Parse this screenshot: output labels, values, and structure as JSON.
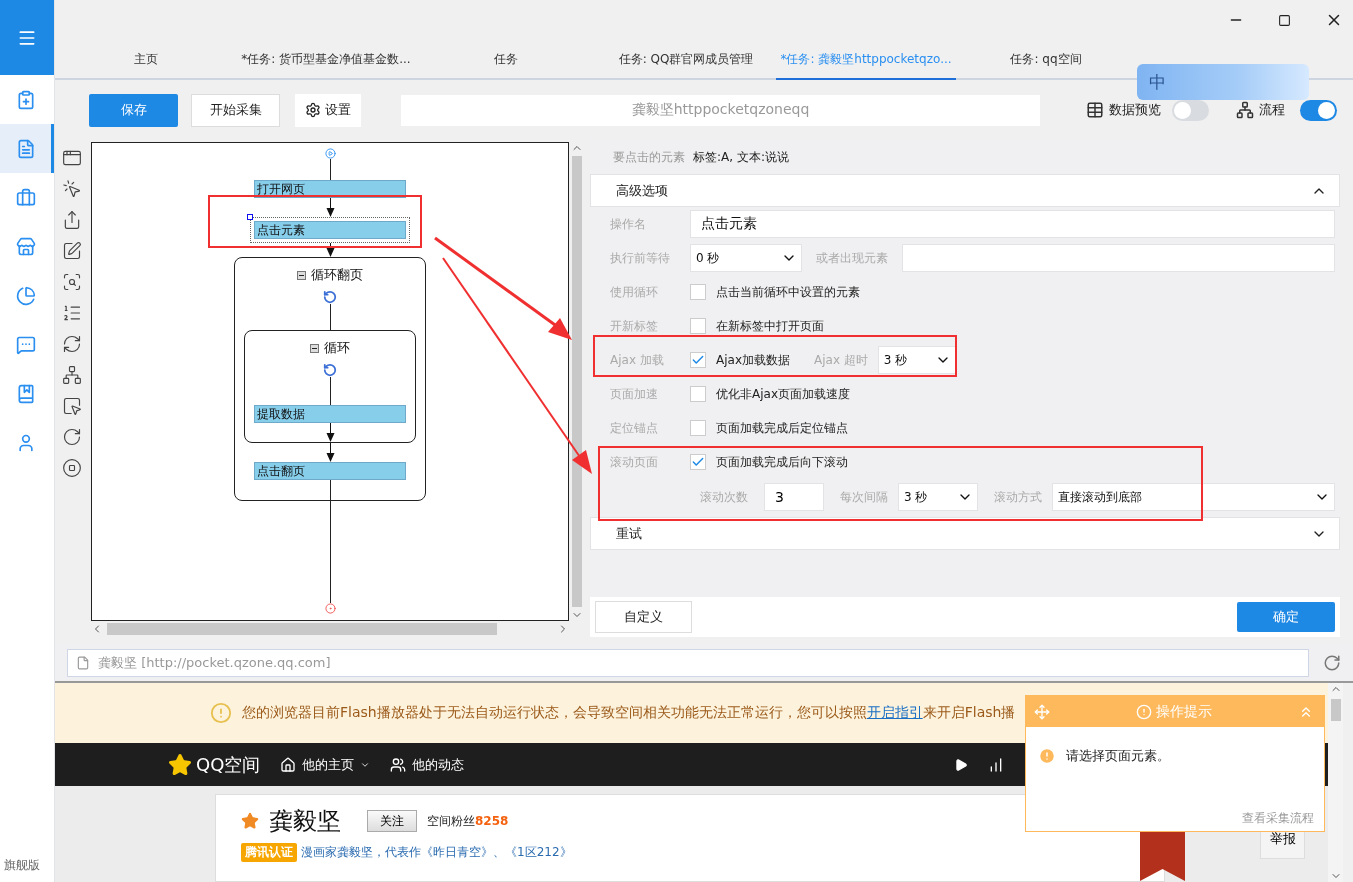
{
  "sidebar": {
    "items": [
      {
        "selected": false
      },
      {
        "selected": true
      },
      {
        "selected": false
      },
      {
        "selected": false
      },
      {
        "selected": false
      },
      {
        "selected": false
      },
      {
        "selected": false
      },
      {
        "selected": false
      }
    ],
    "edition": "旗舰版"
  },
  "tabs": [
    {
      "label": "主页",
      "selected": false
    },
    {
      "label": "*任务: 货币型基金净值基金数...",
      "selected": false
    },
    {
      "label": "任务",
      "selected": false
    },
    {
      "label": "任务: QQ群官网成员管理",
      "selected": false
    },
    {
      "label": "*任务: 龚毅坚httppocketqzo...",
      "selected": true
    },
    {
      "label": "任务: qq空间",
      "selected": false
    }
  ],
  "ime": {
    "label": "中"
  },
  "toolbar": {
    "save": "保存",
    "start": "开始采集",
    "settings": "设置",
    "task_name": "龚毅坚httppocketqzoneqq",
    "data_preview": {
      "label": "数据预览",
      "on": false
    },
    "flow": {
      "label": "流程",
      "on": true
    }
  },
  "flow": [
    {
      "kind": "action",
      "label": "打开网页",
      "selected": false
    },
    {
      "kind": "action",
      "label": "点击元素",
      "selected": true
    },
    {
      "kind": "loop",
      "label": "循环翻页",
      "selected": false,
      "expanded": true,
      "children": [
        {
          "kind": "loop",
          "label": "循环",
          "selected": false,
          "expanded": true,
          "children": [
            {
              "kind": "action",
              "label": "提取数据",
              "selected": false
            }
          ]
        },
        {
          "kind": "action",
          "label": "点击翻页",
          "selected": false
        }
      ]
    }
  ],
  "panel": {
    "target_label": "要点击的元素",
    "target_value": "标签:A, 文本:说说",
    "advanced": {
      "title": "高级选项",
      "expanded": true,
      "rows": [
        {
          "kind": "text",
          "label": "操作名",
          "value": "点击元素"
        },
        {
          "kind": "wait",
          "label": "执行前等待",
          "value": "0 秒",
          "label2": "或者出现元素"
        },
        {
          "kind": "checkbox",
          "label": "使用循环",
          "text": "点击当前循环中设置的元素",
          "checked": false
        },
        {
          "kind": "checkbox",
          "label": "开新标签",
          "text": "在新标签中打开页面",
          "checked": false
        },
        {
          "kind": "checkbox",
          "label": "Ajax 加载",
          "text": "Ajax加载数据",
          "checked": true,
          "extra_label": "Ajax 超时",
          "extra_value": "3 秒"
        },
        {
          "kind": "checkbox",
          "label": "页面加速",
          "text": "优化非Ajax页面加载速度",
          "checked": false
        },
        {
          "kind": "checkbox",
          "label": "定位锚点",
          "text": "页面加载完成后定位锚点",
          "checked": false
        },
        {
          "kind": "checkbox",
          "label": "滚动页面",
          "text": "页面加载完成后向下滚动",
          "checked": true
        },
        {
          "kind": "scroll",
          "count_label": "滚动次数",
          "count": "3",
          "interval_label": "每次间隔",
          "interval": "3 秒",
          "mode_label": "滚动方式",
          "mode": "直接滚动到底部"
        }
      ]
    },
    "retry": {
      "title": "重试",
      "expanded": false
    },
    "custom_button": "自定义",
    "ok_button": "确定"
  },
  "browser": {
    "address": "龚毅坚 [http://pocket.qzone.qq.com]",
    "notice": {
      "before": "您的浏览器目前Flash播放器处于无法自动运行状态，会导致空间相关功能无法正常运行，您可以按照",
      "link": "开启指引",
      "after": "来开启Flash播"
    },
    "nav": {
      "brand": "QQ空间",
      "home": "他的主页",
      "feed": "他的动态"
    },
    "profile": {
      "name": "龚毅坚",
      "follow": "关注",
      "fans_label": "空间粉丝",
      "fans": "8258",
      "badge": "腾讯认证",
      "bio": "漫画家龚毅坚，代表作《昨日青空》、《1区212》"
    },
    "report": "举报"
  },
  "tip": {
    "title": "操作提示",
    "message": "请选择页面元素。",
    "link": "查看采集流程"
  }
}
